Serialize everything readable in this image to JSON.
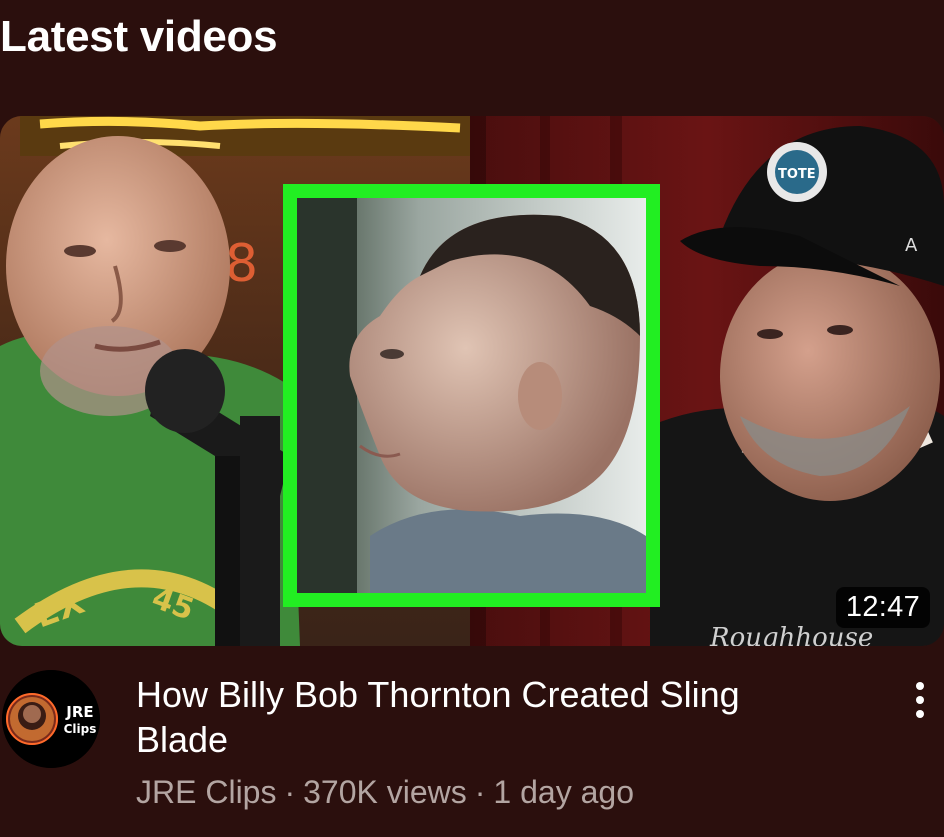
{
  "section": {
    "title": "Latest videos"
  },
  "video": {
    "duration": "12:47",
    "title": "How Billy Bob Thornton Created Sling Blade",
    "channel": "JRE Clips",
    "views": "370K views",
    "age": "1 day ago",
    "separator": "·",
    "avatar_text_line1": "JRE",
    "avatar_text_line2": "Clips",
    "thumbnail_frame_color": "#22ee22",
    "more_icon": "vertical-ellipsis-icon"
  },
  "colors": {
    "background": "#2b0f0d",
    "meta_text": "#b3a5a2"
  }
}
